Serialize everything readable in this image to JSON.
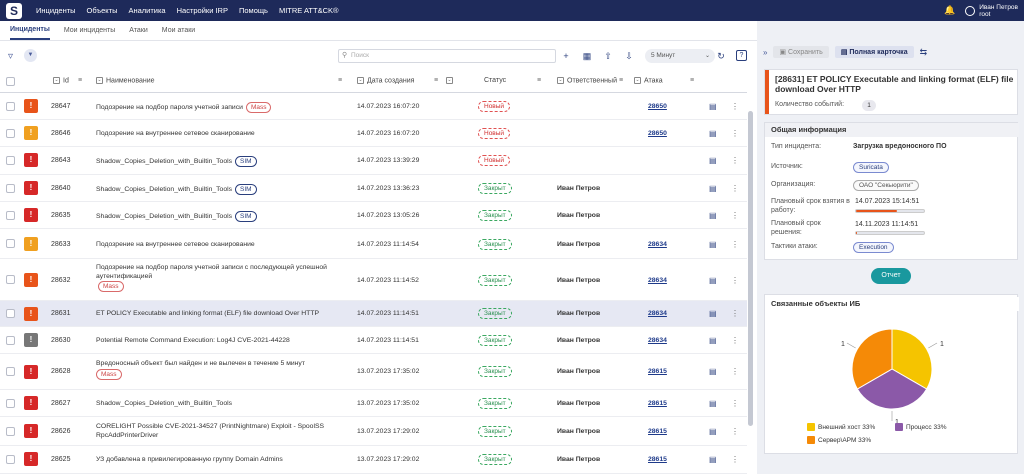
{
  "topbar": {
    "logo": "S",
    "nav": [
      "Инциденты",
      "Объекты",
      "Аналитика",
      "Настройки IRP",
      "Помощь",
      "MITRE ATT&CK®"
    ],
    "user_name": "Иван Петров",
    "user_role": "root"
  },
  "subnav": [
    "Инциденты",
    "Мои инциденты",
    "Атаки",
    "Мои атаки"
  ],
  "toolbar": {
    "search_placeholder": "Поиск",
    "period": "5 Минут"
  },
  "columns": {
    "id": "Id",
    "name": "Наименование",
    "date": "Дата создания",
    "status": "Статус",
    "responsible": "Ответственный",
    "attack": "Атака"
  },
  "rows": [
    {
      "id": "28647",
      "name": "Подозрение на подбор пароля учетной записи",
      "tag": "Mass",
      "date": "14.07.2023 16:07:20",
      "status": "Новый",
      "resp": "",
      "attack": "28650",
      "color": "#e8541a"
    },
    {
      "id": "28646",
      "name": "Подозрение на внутреннее сетевое сканирование",
      "tag": "",
      "date": "14.07.2023 16:07:20",
      "status": "Новый",
      "resp": "",
      "attack": "28650",
      "color": "#f0a020"
    },
    {
      "id": "28643",
      "name": "Shadow_Copies_Deletion_with_Builtin_Tools",
      "tag": "SIM",
      "date": "14.07.2023 13:39:29",
      "status": "Новый",
      "resp": "",
      "attack": "",
      "color": "#d62828"
    },
    {
      "id": "28640",
      "name": "Shadow_Copies_Deletion_with_Builtin_Tools",
      "tag": "SIM",
      "date": "14.07.2023 13:36:23",
      "status": "Закрыт",
      "resp": "Иван Петров",
      "attack": "",
      "color": "#d62828"
    },
    {
      "id": "28635",
      "name": "Shadow_Copies_Deletion_with_Builtin_Tools",
      "tag": "SIM",
      "date": "14.07.2023 13:05:26",
      "status": "Закрыт",
      "resp": "Иван Петров",
      "attack": "",
      "color": "#d62828"
    },
    {
      "id": "28633",
      "name": "Подозрение на внутреннее сетевое сканирование",
      "tag": "",
      "date": "14.07.2023 11:14:54",
      "status": "Закрыт",
      "resp": "Иван Петров",
      "attack": "28634",
      "color": "#f0a020"
    },
    {
      "id": "28632",
      "name": "Подозрение на подбор пароля учетной записи с последующей успешной аутентификацией",
      "tag": "Mass",
      "date": "14.07.2023 11:14:52",
      "status": "Закрыт",
      "resp": "Иван Петров",
      "attack": "28634",
      "color": "#e8541a"
    },
    {
      "id": "28631",
      "name": "ET POLICY Executable and linking format (ELF) file download Over HTTP",
      "tag": "",
      "date": "14.07.2023 11:14:51",
      "status": "Закрыт",
      "resp": "Иван Петров",
      "attack": "28634",
      "color": "#e8541a"
    },
    {
      "id": "28630",
      "name": "Potential Remote Command Execution: Log4J CVE-2021-44228",
      "tag": "",
      "date": "14.07.2023 11:14:51",
      "status": "Закрыт",
      "resp": "Иван Петров",
      "attack": "28634",
      "color": "#777777"
    },
    {
      "id": "28628",
      "name": "Вредоносный объект был найден и не вылечен в течение 5 минут",
      "tag": "Mass",
      "date": "13.07.2023 17:35:02",
      "status": "Закрыт",
      "resp": "Иван Петров",
      "attack": "28615",
      "color": "#d62828"
    },
    {
      "id": "28627",
      "name": "Shadow_Copies_Deletion_with_Builtin_Tools",
      "tag": "",
      "date": "13.07.2023 17:35:02",
      "status": "Закрыт",
      "resp": "Иван Петров",
      "attack": "28615",
      "color": "#d62828"
    },
    {
      "id": "28626",
      "name": "CORELIGHT Possible CVE-2021-34527 (PrintNightmare) Exploit - SpoolSS RpcAddPrinterDriver",
      "tag": "",
      "date": "13.07.2023 17:29:02",
      "status": "Закрыт",
      "resp": "Иван Петров",
      "attack": "28615",
      "color": "#d62828"
    },
    {
      "id": "28625",
      "name": "УЗ добавлена в привилегированную группу Domain Admins",
      "tag": "",
      "date": "13.07.2023 17:29:02",
      "status": "Закрыт",
      "resp": "Иван Петров",
      "attack": "28615",
      "color": "#d62828"
    }
  ],
  "panel": {
    "save": "Сохранить",
    "full_card": "Полная карточка",
    "title": "[28631] ET POLICY Executable and linking format (ELF) file download Over HTTP",
    "events_label": "Количество событий:",
    "events_count": "1",
    "general_info": "Общая информация",
    "type_label": "Тип инцидента:",
    "type_value": "Загрузка вредоносного ПО",
    "source_label": "Источник:",
    "source_value": "Suricata",
    "org_label": "Организация:",
    "org_value": "ОАО \"Секьюрити\"",
    "take_label": "Плановый срок взятия в работу:",
    "take_value": "14.07.2023 15:14:51",
    "take_progress": 0.6,
    "solve_label": "Плановый срок решения:",
    "solve_value": "14.11.2023 11:14:51",
    "solve_progress": 0.02,
    "tactics_label": "Тактики атаки:",
    "tactics_value": "Execution",
    "report": "Отчет",
    "related": "Связанные объекты ИБ"
  },
  "chart_data": {
    "type": "pie",
    "title": "",
    "slices": [
      {
        "label": "Внешний хост 33%",
        "value": 1,
        "color": "#f5c400"
      },
      {
        "label": "Процесс 33%",
        "value": 1,
        "color": "#8b59a8"
      },
      {
        "label": "Сервер\\АРМ 33%",
        "value": 1,
        "color": "#f58a07"
      }
    ],
    "data_labels": [
      "1",
      "1",
      "1"
    ]
  }
}
